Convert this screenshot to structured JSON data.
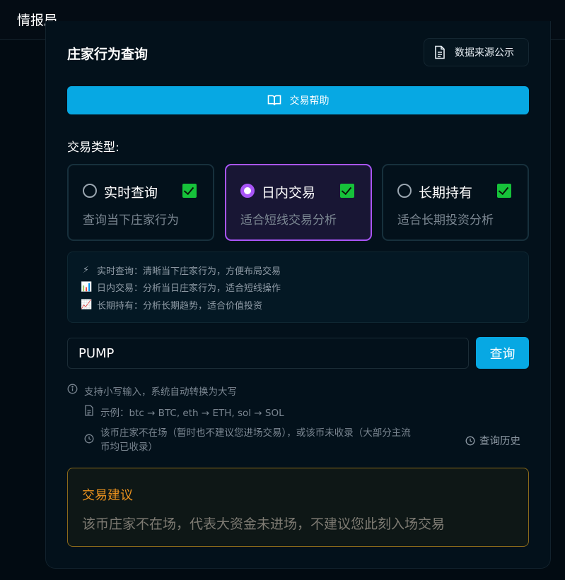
{
  "topbar": {
    "brand": "情报局"
  },
  "card": {
    "title": "庄家行为查询",
    "source_button": "数据来源公示",
    "help_button": "交易帮助"
  },
  "trade_types": {
    "label": "交易类型:",
    "options": [
      {
        "name": "实时查询",
        "desc": "查询当下庄家行为",
        "selected": false,
        "checked": true
      },
      {
        "name": "日内交易",
        "desc": "适合短线交易分析",
        "selected": true,
        "checked": true
      },
      {
        "name": "长期持有",
        "desc": "适合长期投资分析",
        "selected": false,
        "checked": true
      }
    ]
  },
  "info": {
    "lines": [
      {
        "icon": "lightning-icon",
        "emoji": "⚡",
        "text": "实时查询：清晰当下庄家行为，方便布局交易"
      },
      {
        "icon": "bar-chart-icon",
        "emoji": "📊",
        "text": "日内交易：分析当日庄家行为，适合短线操作"
      },
      {
        "icon": "trend-up-icon",
        "emoji": "📈",
        "text": "长期持有：分析长期趋势，适合价值投资"
      }
    ]
  },
  "search": {
    "value": "PUMP",
    "button": "查询"
  },
  "tips": {
    "line1": "支持小写输入，系统自动转换为大写",
    "line2": "示例：btc → BTC, eth → ETH, sol → SOL",
    "line3a": "该币庄家不在场（暂时也不建议您进场交易），或该币未收录（大部分主流",
    "line3b": "币均已收录）",
    "history": "查询历史"
  },
  "advice": {
    "title": "交易建议",
    "text": "该币庄家不在场，代表大资金未进场，不建议您此刻入场交易"
  },
  "colors": {
    "accent": "#07a8e3",
    "selected_border": "#a855f7",
    "check": "#16c23a",
    "advice_title": "#e8901e"
  }
}
